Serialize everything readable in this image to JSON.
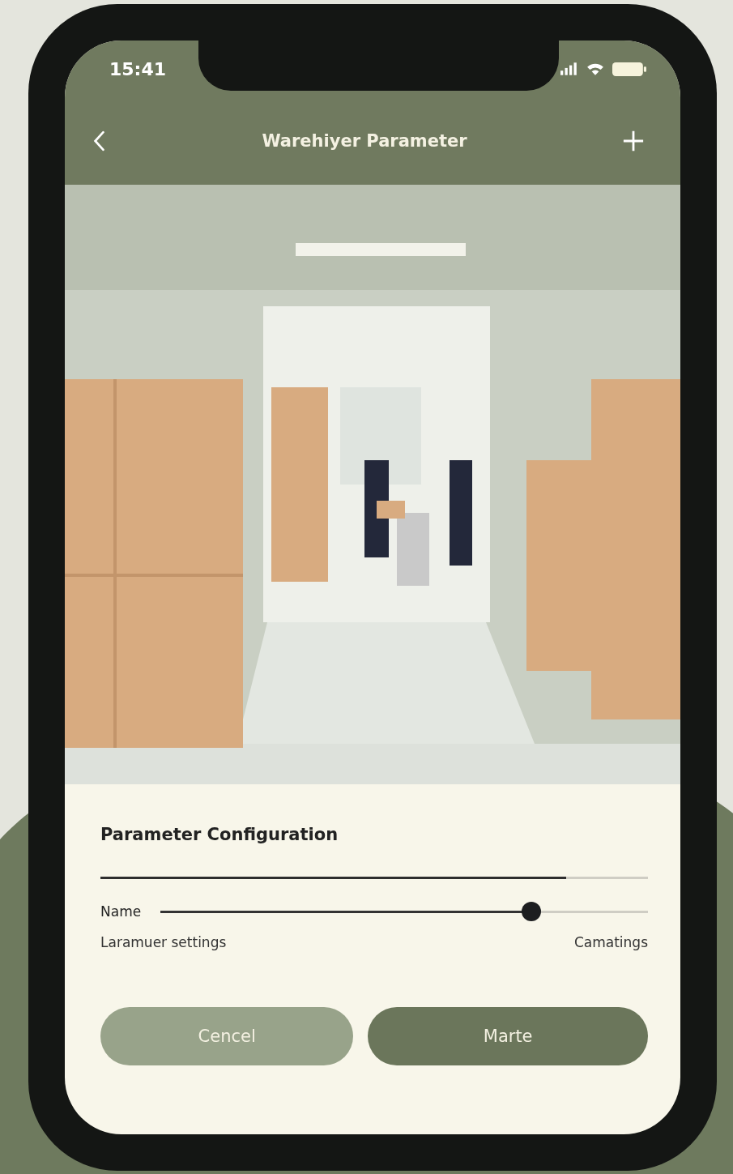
{
  "status_bar": {
    "time": "15:41"
  },
  "nav": {
    "title": "Warehiyer Parameter"
  },
  "panel": {
    "title": "Parameter Configuration",
    "progress": {
      "level": 0.85
    },
    "slider": {
      "label": "Name",
      "level": 0.76
    },
    "left_caption": "Laramuer settings",
    "right_caption": "Camatings"
  },
  "buttons": [
    {
      "label": "Cencel",
      "kind": "secondary"
    },
    {
      "label": "Marte",
      "kind": "primary"
    }
  ]
}
